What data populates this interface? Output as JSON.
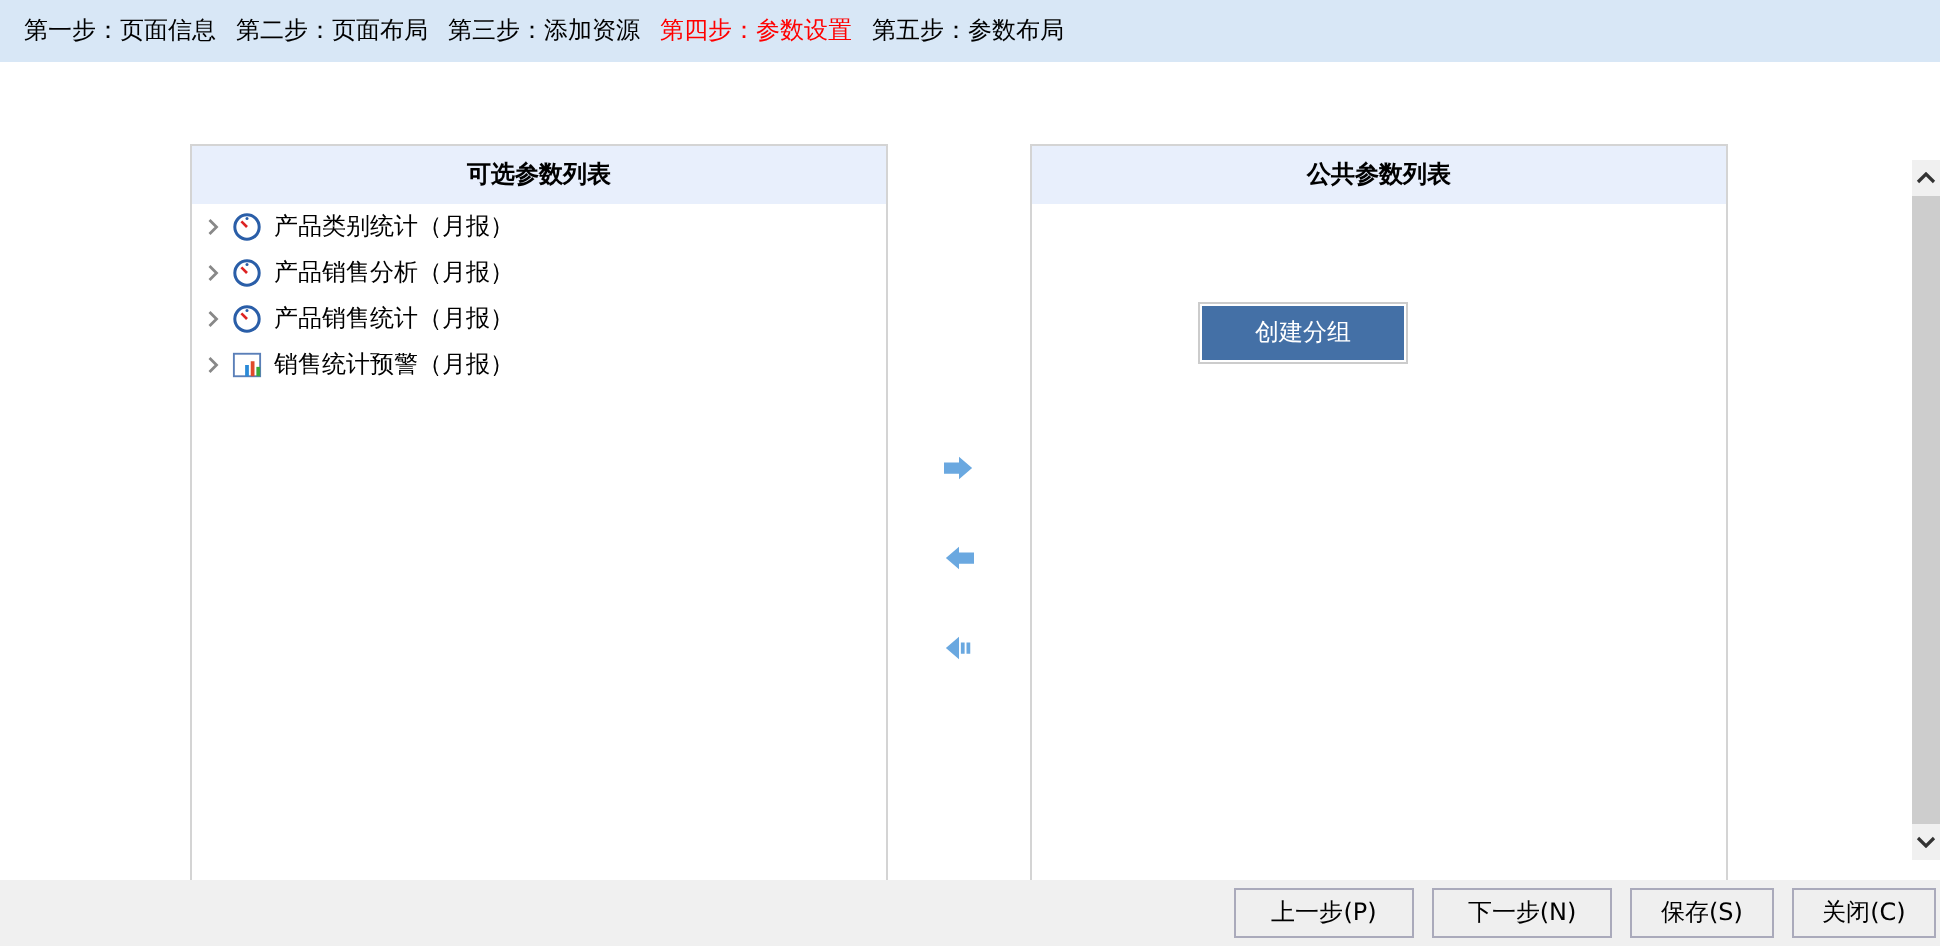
{
  "steps": [
    {
      "label": "第一步：页面信息",
      "selected": false
    },
    {
      "label": "第二步：页面布局",
      "selected": false
    },
    {
      "label": "第三步：添加资源",
      "selected": false
    },
    {
      "label": "第四步：参数设置",
      "selected": true
    },
    {
      "label": "第五步：参数布局",
      "selected": false
    }
  ],
  "available_panel": {
    "title": "可选参数列表",
    "items": [
      {
        "label": "产品类别统计（月报）",
        "kind": "gauge",
        "expanded": false
      },
      {
        "label": "产品销售分析（月报）",
        "kind": "gauge",
        "expanded": false
      },
      {
        "label": "产品销售统计（月报）",
        "kind": "gauge",
        "expanded": false
      },
      {
        "label": "销售统计预警（月报）",
        "kind": "chart",
        "expanded": false
      }
    ]
  },
  "public_panel": {
    "title": "公共参数列表",
    "create_group_button": "创建分组"
  },
  "buttons": [
    "上一步(P)",
    "下一步(N)",
    "保存(S)",
    "关闭(C)"
  ]
}
